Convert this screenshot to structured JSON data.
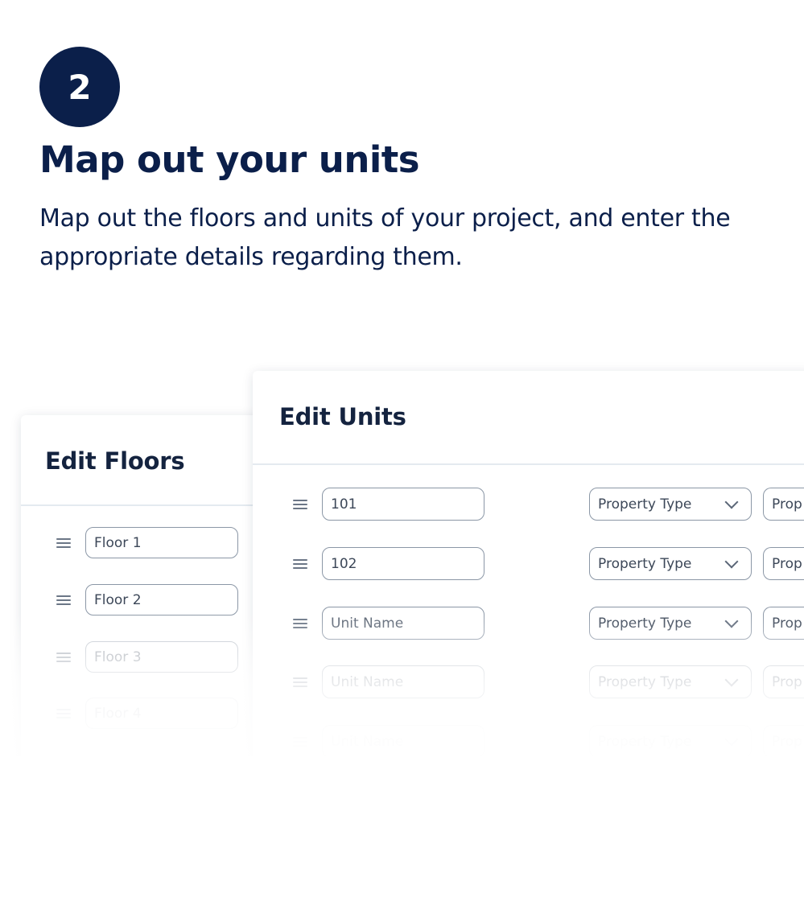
{
  "step": {
    "number": "2"
  },
  "headline": "Map out your units",
  "subtext": "Map out the floors and units of your project, and enter the appropriate details regarding them.",
  "colors": {
    "primary": "#0b1f4a",
    "border": "#8b97a6",
    "divider": "#e4eaf0"
  },
  "floors_card": {
    "title": "Edit Floors",
    "rows": [
      {
        "value": "Floor 1",
        "state": "filled"
      },
      {
        "value": "Floor 2",
        "state": "filled"
      },
      {
        "value": "Floor 3",
        "state": "faded"
      },
      {
        "value": "Floor 4",
        "state": "faded"
      }
    ]
  },
  "units_card": {
    "title": "Edit Units",
    "rows": [
      {
        "name": "101",
        "name_placeholder": "Unit Name",
        "type": "Property Type",
        "type2": "Prop"
      },
      {
        "name": "102",
        "name_placeholder": "Unit Name",
        "type": "Property Type",
        "type2": "Prop"
      },
      {
        "name": "",
        "name_placeholder": "Unit Name",
        "type": "Property Type",
        "type2": "Prop"
      },
      {
        "name": "",
        "name_placeholder": "Unit Name",
        "type": "Property Type",
        "type2": "Prop"
      },
      {
        "name": "",
        "name_placeholder": "Unit Name",
        "type": "Property Type",
        "type2": "Prop"
      }
    ]
  },
  "icons": {
    "drag_handle": "drag-handle-icon",
    "dropdown": "chevron-down-icon"
  }
}
